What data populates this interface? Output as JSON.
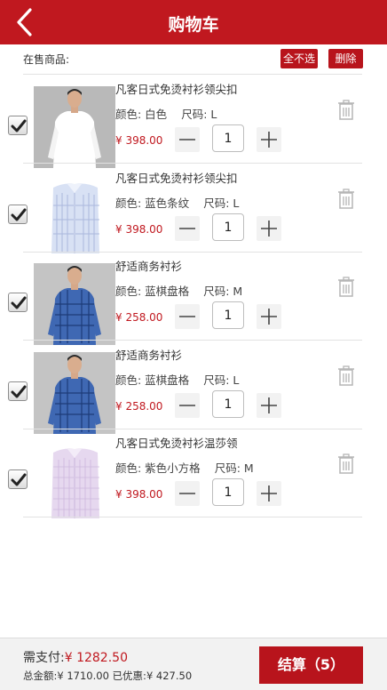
{
  "header": {
    "title": "购物车"
  },
  "subbar": {
    "label": "在售商品:",
    "unselect_all": "全不选",
    "delete": "删除"
  },
  "items": [
    {
      "name": "凡客日式免烫衬衫领尖扣",
      "color_label": "颜色: 白色",
      "size_label": "尺码: L",
      "price": "¥ 398.00",
      "qty": "1",
      "checked": true
    },
    {
      "name": "凡客日式免烫衬衫领尖扣",
      "color_label": "颜色: 蓝色条纹",
      "size_label": "尺码: L",
      "price": "¥ 398.00",
      "qty": "1",
      "checked": true
    },
    {
      "name": "舒适商务衬衫",
      "color_label": "颜色: 蓝棋盘格",
      "size_label": "尺码: M",
      "price": "¥ 258.00",
      "qty": "1",
      "checked": true
    },
    {
      "name": "舒适商务衬衫",
      "color_label": "颜色: 蓝棋盘格",
      "size_label": "尺码: L",
      "price": "¥ 258.00",
      "qty": "1",
      "checked": true
    },
    {
      "name": "凡客日式免烫衬衫温莎领",
      "color_label": "颜色: 紫色小方格",
      "size_label": "尺码: M",
      "price": "¥ 398.00",
      "qty": "1",
      "checked": true
    }
  ],
  "footer": {
    "need_pay_label": "需支付:",
    "need_pay_amount": "¥ 1282.50",
    "total_label": "总金额:",
    "total_amount": "¥ 1710.00",
    "discount_label": "已优惠:",
    "discount_amount": "¥ 427.50",
    "checkout_label": "结算（5）"
  },
  "colors": {
    "brand_red": "#c0181f",
    "price_red": "#c0181f",
    "footer_bg": "#f2f2f2"
  }
}
